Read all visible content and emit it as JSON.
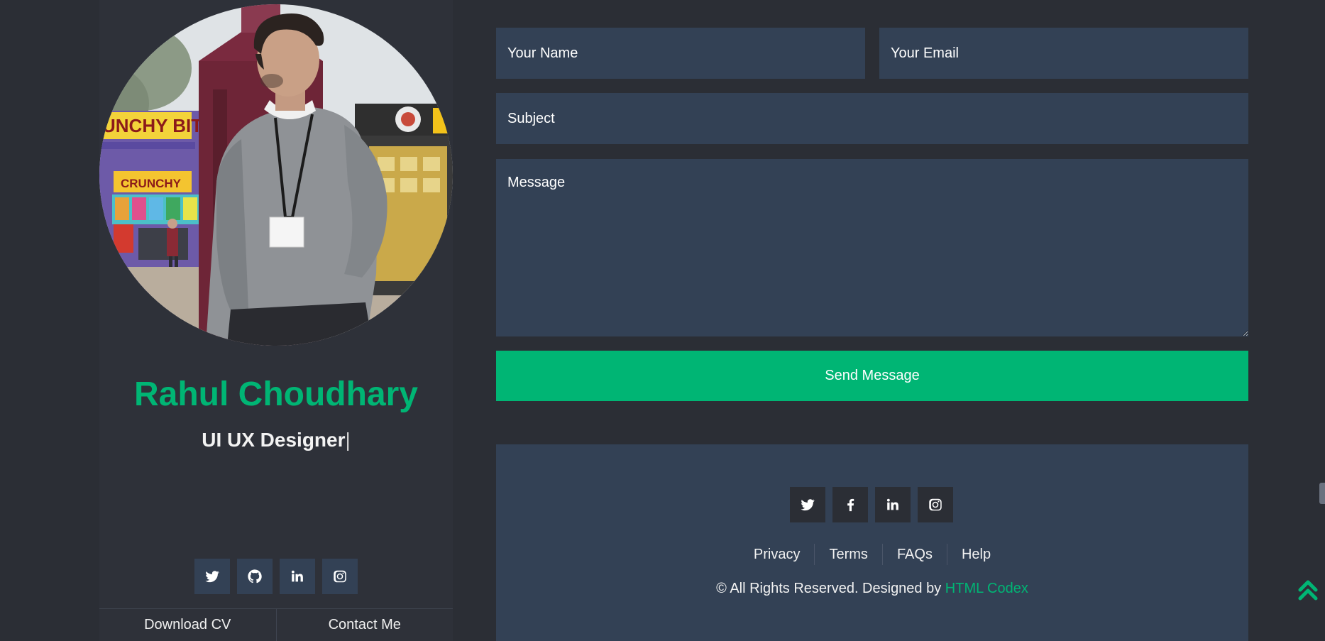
{
  "colors": {
    "accent": "#00b574",
    "background": "#2b2e35",
    "sidebar": "#2e3139",
    "field": "#334155"
  },
  "profile": {
    "name": "Rahul Choudhary",
    "role": "UI UX Designer",
    "cursor": "|",
    "photo_signage": [
      "UNCHY BITE",
      "CRUNCHY"
    ]
  },
  "sidebar_social": [
    {
      "icon": "twitter-icon"
    },
    {
      "icon": "github-icon"
    },
    {
      "icon": "linkedin-icon"
    },
    {
      "icon": "instagram-icon"
    }
  ],
  "sidebar_actions": {
    "download_cv": "Download CV",
    "contact_me": "Contact Me"
  },
  "contact_form": {
    "name_placeholder": "Your Name",
    "email_placeholder": "Your Email",
    "subject_placeholder": "Subject",
    "message_placeholder": "Message",
    "submit_label": "Send Message"
  },
  "footer": {
    "social": [
      {
        "icon": "twitter-icon"
      },
      {
        "icon": "facebook-icon"
      },
      {
        "icon": "linkedin-icon"
      },
      {
        "icon": "instagram-icon"
      }
    ],
    "links": [
      "Privacy",
      "Terms",
      "FAQs",
      "Help"
    ],
    "copyright_prefix": "© All Rights Reserved. Designed by",
    "brand": "HTML Codex"
  },
  "floating": {
    "back_to_top_icon": "double-chevron-up-icon"
  }
}
